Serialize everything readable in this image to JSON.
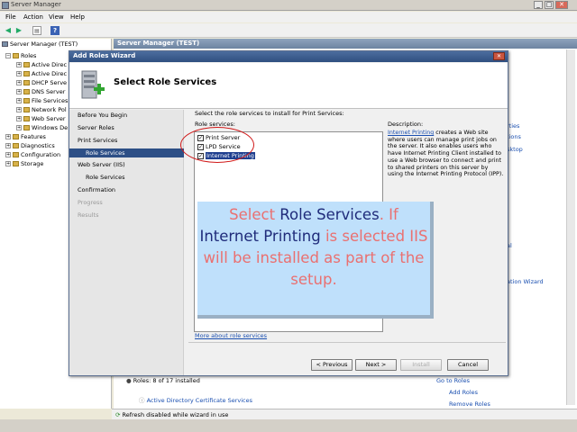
{
  "window": {
    "title": "Server Manager",
    "controls": [
      "_",
      "□",
      "✕"
    ]
  },
  "menubar": [
    "File",
    "Action",
    "View",
    "Help"
  ],
  "toolbar": [
    "back-arrow",
    "forward-arrow",
    "up-level",
    "help"
  ],
  "tree": {
    "root": "Server Manager (TEST)",
    "items": [
      {
        "label": "Roles",
        "level": 1,
        "expander": "−"
      },
      {
        "label": "Active Direc",
        "level": 2,
        "expander": "+"
      },
      {
        "label": "Active Direc",
        "level": 2,
        "expander": "+"
      },
      {
        "label": "DHCP Serve",
        "level": 2,
        "expander": "+"
      },
      {
        "label": "DNS Server",
        "level": 2,
        "expander": "+"
      },
      {
        "label": "File Services",
        "level": 2,
        "expander": "+"
      },
      {
        "label": "Network Pol",
        "level": 2,
        "expander": "+"
      },
      {
        "label": "Web Server",
        "level": 2,
        "expander": "+"
      },
      {
        "label": "Windows De",
        "level": 2,
        "expander": "+"
      },
      {
        "label": "Features",
        "level": 1,
        "expander": "+"
      },
      {
        "label": "Diagnostics",
        "level": 1,
        "expander": "+"
      },
      {
        "label": "Configuration",
        "level": 1,
        "expander": "+"
      },
      {
        "label": "Storage",
        "level": 1,
        "expander": "+"
      }
    ]
  },
  "rightpane": {
    "header": "Server Manager (TEST)",
    "links": [
      "rties",
      "tions",
      "sktop",
      "al",
      "ation Wizard"
    ],
    "roles_summary": "Roles: 8 of 17 installed",
    "role_item": "Active Directory Certificate Services",
    "actions": [
      "Go to Roles",
      "Add Roles",
      "Remove Roles"
    ]
  },
  "status": "Refresh disabled while wizard in use",
  "wizard": {
    "title": "Add Roles Wizard",
    "heading": "Select Role Services",
    "steps": [
      {
        "label": "Before You Begin",
        "state": "normal",
        "indent": false
      },
      {
        "label": "Server Roles",
        "state": "normal",
        "indent": false
      },
      {
        "label": "Print Services",
        "state": "normal",
        "indent": false
      },
      {
        "label": "Role Services",
        "state": "active",
        "indent": true
      },
      {
        "label": "Web Server (IIS)",
        "state": "normal",
        "indent": false
      },
      {
        "label": "Role Services",
        "state": "normal",
        "indent": true
      },
      {
        "label": "Confirmation",
        "state": "normal",
        "indent": false
      },
      {
        "label": "Progress",
        "state": "disabled",
        "indent": false
      },
      {
        "label": "Results",
        "state": "disabled",
        "indent": false
      }
    ],
    "intro": "Select the role services to install for Print Services:",
    "role_services_label": "Role services:",
    "role_services": [
      {
        "label": "Print Server",
        "checked": true,
        "selected": false
      },
      {
        "label": "LPD Service",
        "checked": true,
        "selected": false
      },
      {
        "label": "Internet Printing",
        "checked": true,
        "selected": true
      }
    ],
    "description_label": "Description:",
    "description_link": "Internet Printing",
    "description_text": " creates a Web site where users can manage print jobs on the server. It also enables users who have Internet Printing Client installed to use a Web browser to connect and print to shared printers on this server by using the Internet Printing Protocol (IPP).",
    "more_link": "More about role services",
    "buttons": {
      "previous": "< Previous",
      "next": "Next >",
      "install": "Install",
      "cancel": "Cancel"
    }
  },
  "callout": {
    "part1": "Select ",
    "part2": "Role Services",
    "part3": ". If ",
    "part4": "Internet Printing",
    "part5": " is selected IIS will be installed as part of the setup."
  },
  "colors": {
    "wizard_title": "#2f4f80",
    "active_step": "#2d4f86",
    "annotation_ellipse": "#d01818",
    "callout_bg": "#bfe0fb",
    "callout_pink": "#ea7070",
    "callout_blue": "#1f2b7a"
  }
}
